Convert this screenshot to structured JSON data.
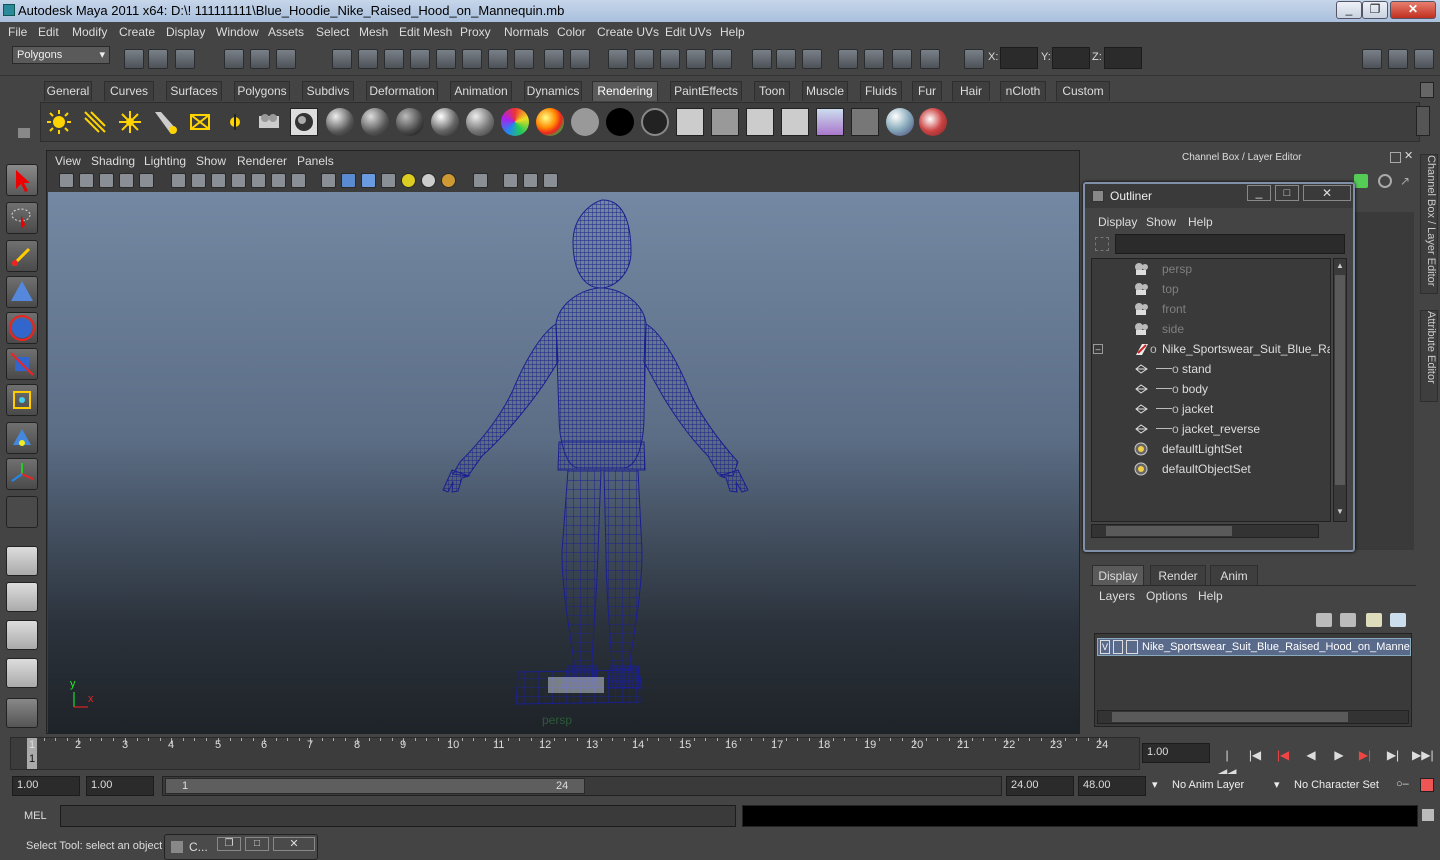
{
  "window": {
    "title": "Autodesk Maya 2011 x64: D:\\! 111111111\\Blue_Hoodie_Nike_Raised_Hood_on_Mannequin.mb"
  },
  "menubar": [
    "File",
    "Edit",
    "Modify",
    "Create",
    "Display",
    "Window",
    "Assets",
    "Select",
    "Mesh",
    "Edit Mesh",
    "Proxy",
    "Normals",
    "Color",
    "Create UVs",
    "Edit UVs",
    "Help"
  ],
  "statusline": {
    "mode": "Polygons",
    "x_label": "X:",
    "y_label": "Y:",
    "z_label": "Z:"
  },
  "shelf_tabs": [
    "General",
    "Curves",
    "Surfaces",
    "Polygons",
    "Subdivs",
    "Deformation",
    "Animation",
    "Dynamics",
    "Rendering",
    "PaintEffects",
    "Toon",
    "Muscle",
    "Fluids",
    "Fur",
    "Hair",
    "nCloth",
    "Custom"
  ],
  "active_shelf_tab": "Rendering",
  "viewport": {
    "menu": [
      "View",
      "Shading",
      "Lighting",
      "Show",
      "Renderer",
      "Panels"
    ],
    "camera_label": "persp",
    "axis_y": "y",
    "axis_x": "x"
  },
  "channel_box_title": "Channel Box / Layer Editor",
  "outliner": {
    "title": "Outliner",
    "menu": [
      "Display",
      "Show",
      "Help"
    ],
    "items": [
      {
        "label": "persp",
        "type": "camera"
      },
      {
        "label": "top",
        "type": "camera"
      },
      {
        "label": "front",
        "type": "camera"
      },
      {
        "label": "side",
        "type": "camera"
      },
      {
        "label": "Nike_Sportswear_Suit_Blue_Raised",
        "type": "group"
      },
      {
        "label": "stand",
        "type": "mesh"
      },
      {
        "label": "body",
        "type": "mesh"
      },
      {
        "label": "jacket",
        "type": "mesh"
      },
      {
        "label": "jacket_reverse",
        "type": "mesh"
      },
      {
        "label": "defaultLightSet",
        "type": "set"
      },
      {
        "label": "defaultObjectSet",
        "type": "set"
      }
    ]
  },
  "layer_editor": {
    "tabs": [
      "Display",
      "Render",
      "Anim"
    ],
    "menu": [
      "Layers",
      "Options",
      "Help"
    ],
    "layer_name": "Nike_Sportswear_Suit_Blue_Raised_Hood_on_Mannequi",
    "layer_v": "V"
  },
  "side_tabs": [
    "Channel Box / Layer Editor",
    "Attribute Editor"
  ],
  "timeline": {
    "ticks": [
      "1",
      "2",
      "3",
      "4",
      "5",
      "6",
      "7",
      "8",
      "9",
      "10",
      "11",
      "12",
      "13",
      "14",
      "15",
      "16",
      "17",
      "18",
      "19",
      "20",
      "21",
      "22",
      "23",
      "24"
    ],
    "current_frame": "1",
    "current_time_field": "1.00"
  },
  "range": {
    "start": "1.00",
    "playback_start": "1.00",
    "slider_start": "1",
    "slider_end": "24",
    "playback_end": "24.00",
    "end": "48.00",
    "anim_layer": "No Anim Layer",
    "character_set": "No Character Set"
  },
  "command_line": {
    "label": "MEL"
  },
  "status_text": "Select Tool: select an object",
  "minimized_window": {
    "label": "C..."
  }
}
